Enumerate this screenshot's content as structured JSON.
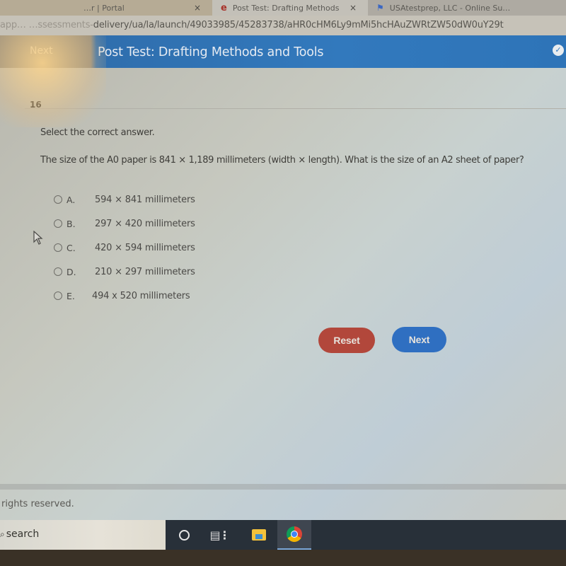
{
  "browser": {
    "tabs": [
      {
        "label": "…r | Portal",
        "active": false
      },
      {
        "label": "Post Test: Drafting Methods",
        "favicon": "edmentum-e-icon",
        "active": true
      },
      {
        "label": "USAtestprep, LLC - Online Su…",
        "favicon": "bookmark-icon",
        "active": false
      }
    ],
    "close_glyph": "×",
    "url_prefix": "app…     …ssessments-",
    "url": "delivery/ua/la/launch/49033985/45283738/aHR0cHM6Ly9mMi5hcHAuZWRtZW50dW0uY29t"
  },
  "app": {
    "nav_next_label": "Next",
    "title": "Post Test: Drafting Methods and Tools",
    "status_icon": "check-circle-icon"
  },
  "question": {
    "number": "16",
    "instruction": "Select the correct answer.",
    "text": "The size of the A0 paper is 841 × 1,189 millimeters (width × length). What is the size of an A2 sheet of paper?",
    "options": [
      {
        "letter": "A.",
        "text": "594 × 841 millimeters",
        "selected": false
      },
      {
        "letter": "B.",
        "text": "297 × 420 millimeters",
        "selected": false
      },
      {
        "letter": "C.",
        "text": "420 × 594 millimeters",
        "selected": false
      },
      {
        "letter": "D.",
        "text": "210 × 297 millimeters",
        "selected": false
      },
      {
        "letter": "E.",
        "text": "494 x 520 millimeters",
        "selected": false
      }
    ]
  },
  "actions": {
    "reset_label": "Reset",
    "next_label": "Next",
    "reset_color": "#b2473b",
    "next_color": "#2f6fc1"
  },
  "footer": {
    "text": "rights reserved."
  },
  "taskbar": {
    "search_label": "search",
    "icons": [
      "cortana-icon",
      "task-view-icon",
      "file-explorer-icon",
      "chrome-icon"
    ],
    "active_app": "chrome-icon"
  },
  "colors": {
    "header_blue": "#3279bd"
  }
}
